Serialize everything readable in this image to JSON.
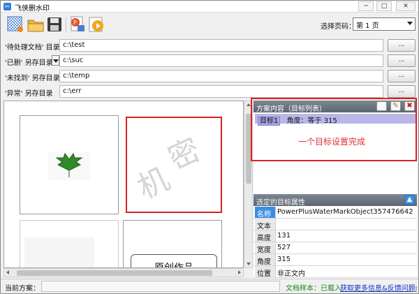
{
  "window": {
    "title": "飞侠删水印",
    "min": "─",
    "max": "□",
    "close": "✕"
  },
  "toolbar": {
    "buttons": [
      {
        "name": "new-transparent",
        "icon": "grid-icon"
      },
      {
        "name": "open-folder",
        "icon": "folder-icon"
      },
      {
        "name": "save",
        "icon": "floppy-icon"
      },
      {
        "name": "ppt-export",
        "icon": "ppt-icon"
      },
      {
        "name": "run",
        "icon": "play-icon"
      }
    ],
    "page_label": "选择页码：",
    "page_value": "第 1 页"
  },
  "paths": [
    {
      "label_a": "'待处理文档' 目录",
      "required": "*",
      "value": "c:\\test",
      "browse": "..."
    },
    {
      "label_a": "'已删'",
      "label_b": "另存目录",
      "value": "c:\\suc",
      "browse": "..."
    },
    {
      "label_a": "'未找到' 另存目录",
      "value": "c:\\temp",
      "browse": "..."
    },
    {
      "label_a": "'异常'",
      "label_b": "另存目录",
      "value": "c:\\err",
      "browse": "..."
    }
  ],
  "canvas": {
    "watermark_chars": [
      "机",
      "密"
    ],
    "doc_text": "原创作品"
  },
  "scheme": {
    "header": "方案内容（目标列表）",
    "row_tag": "目标1",
    "row_text": "角度：等于 315",
    "annotation": "一个目标设置完成",
    "btn_list": "☰",
    "btn_edit": "✎",
    "btn_delete": "✖"
  },
  "props": {
    "header": "选定的目标属性",
    "rows": [
      {
        "key": "名称",
        "value": "PowerPlusWaterMarkObject357476642"
      },
      {
        "key": "文本",
        "value": ""
      },
      {
        "key": "高度",
        "value": "131"
      },
      {
        "key": "宽度",
        "value": "527"
      },
      {
        "key": "角度",
        "value": "315"
      },
      {
        "key": "位置",
        "value": "非正文内"
      }
    ]
  },
  "status": {
    "label": "当前方案：",
    "sample": "文档样本：已载入",
    "link": "获取更多信息&反馈问题"
  },
  "colors": {
    "accent_red": "#e02020",
    "selection": "#b9b6ea",
    "status_green": "#1a8a1a",
    "link_blue": "#1030c0"
  }
}
